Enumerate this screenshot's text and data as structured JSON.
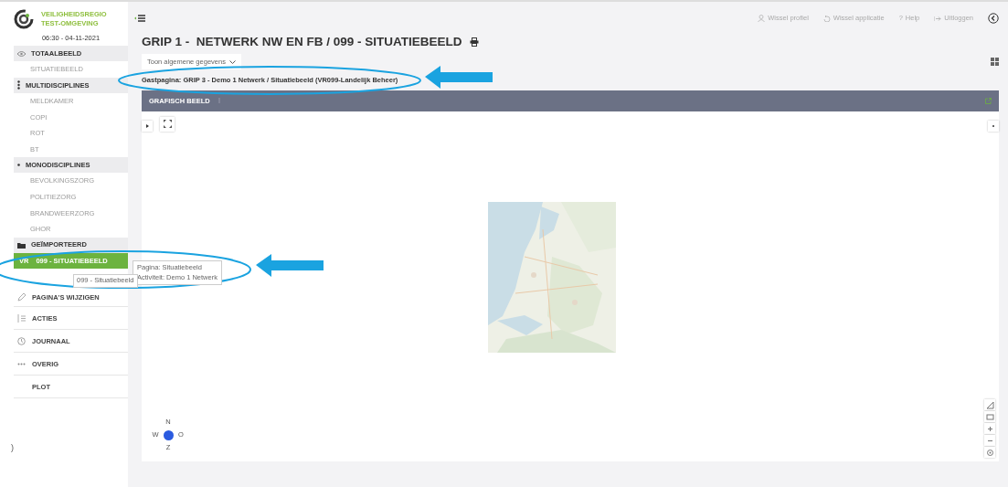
{
  "sidebar": {
    "brand": {
      "line1": "VEILIGHEIDSREGIO",
      "line2": "TEST-OMGEVING"
    },
    "datetime": "06:30 - 04-11-2021",
    "groups": [
      {
        "title": "TOTAALBEELD",
        "items": [
          {
            "label": "SITUATIEBEELD",
            "selected": false
          }
        ]
      },
      {
        "title": "MULTIDISCIPLINES",
        "items": [
          {
            "label": "MELDKAMER",
            "selected": false
          },
          {
            "label": "COPI",
            "selected": false
          },
          {
            "label": "ROT",
            "selected": false
          },
          {
            "label": "BT",
            "selected": false
          }
        ]
      },
      {
        "title": "MONODISCIPLINES",
        "items": [
          {
            "label": "BEVOLKINGSZORG",
            "selected": false
          },
          {
            "label": "POLITIEZORG",
            "selected": false
          },
          {
            "label": "BRANDWEERZORG",
            "selected": false
          },
          {
            "label": "GHOR",
            "selected": false
          }
        ]
      },
      {
        "title": "GEÏMPORTEERD",
        "items": [
          {
            "prefix": "VR",
            "label": "099 - SITUATIEBEELD",
            "selected": true
          }
        ]
      }
    ],
    "menu": [
      {
        "label": "PAGINA'S WIJZIGEN"
      },
      {
        "label": "ACTIES"
      },
      {
        "label": "JOURNAAL"
      },
      {
        "label": "OVERIG"
      },
      {
        "label": "PLOT"
      }
    ],
    "handle": ")"
  },
  "tooltips": {
    "activity": [
      "Pagina: Situatiebeeld",
      "Activiteit: Demo 1 Netwerk"
    ],
    "item": "099 - Situatiebeeld"
  },
  "header": {
    "links": [
      {
        "label": "Wissel profiel"
      },
      {
        "label": "Wissel applicatie"
      },
      {
        "char": "?",
        "label": "Help"
      },
      {
        "label": "Uitloggen"
      }
    ]
  },
  "title": "GRIP 1 -  NETWERK NW EN FB / 099 - SITUATIEBEELD",
  "dropdown": "Toon algemene gegevens",
  "guest_page": "Gastpagina: GRIP 3 - Demo 1 Netwerk / Situatiebeeld (VR099-Landelijk Beheer)",
  "panel": {
    "title": "GRAFISCH BEELD",
    "compass": {
      "n": "N",
      "w": "W",
      "e": "O",
      "s": "Z"
    }
  }
}
